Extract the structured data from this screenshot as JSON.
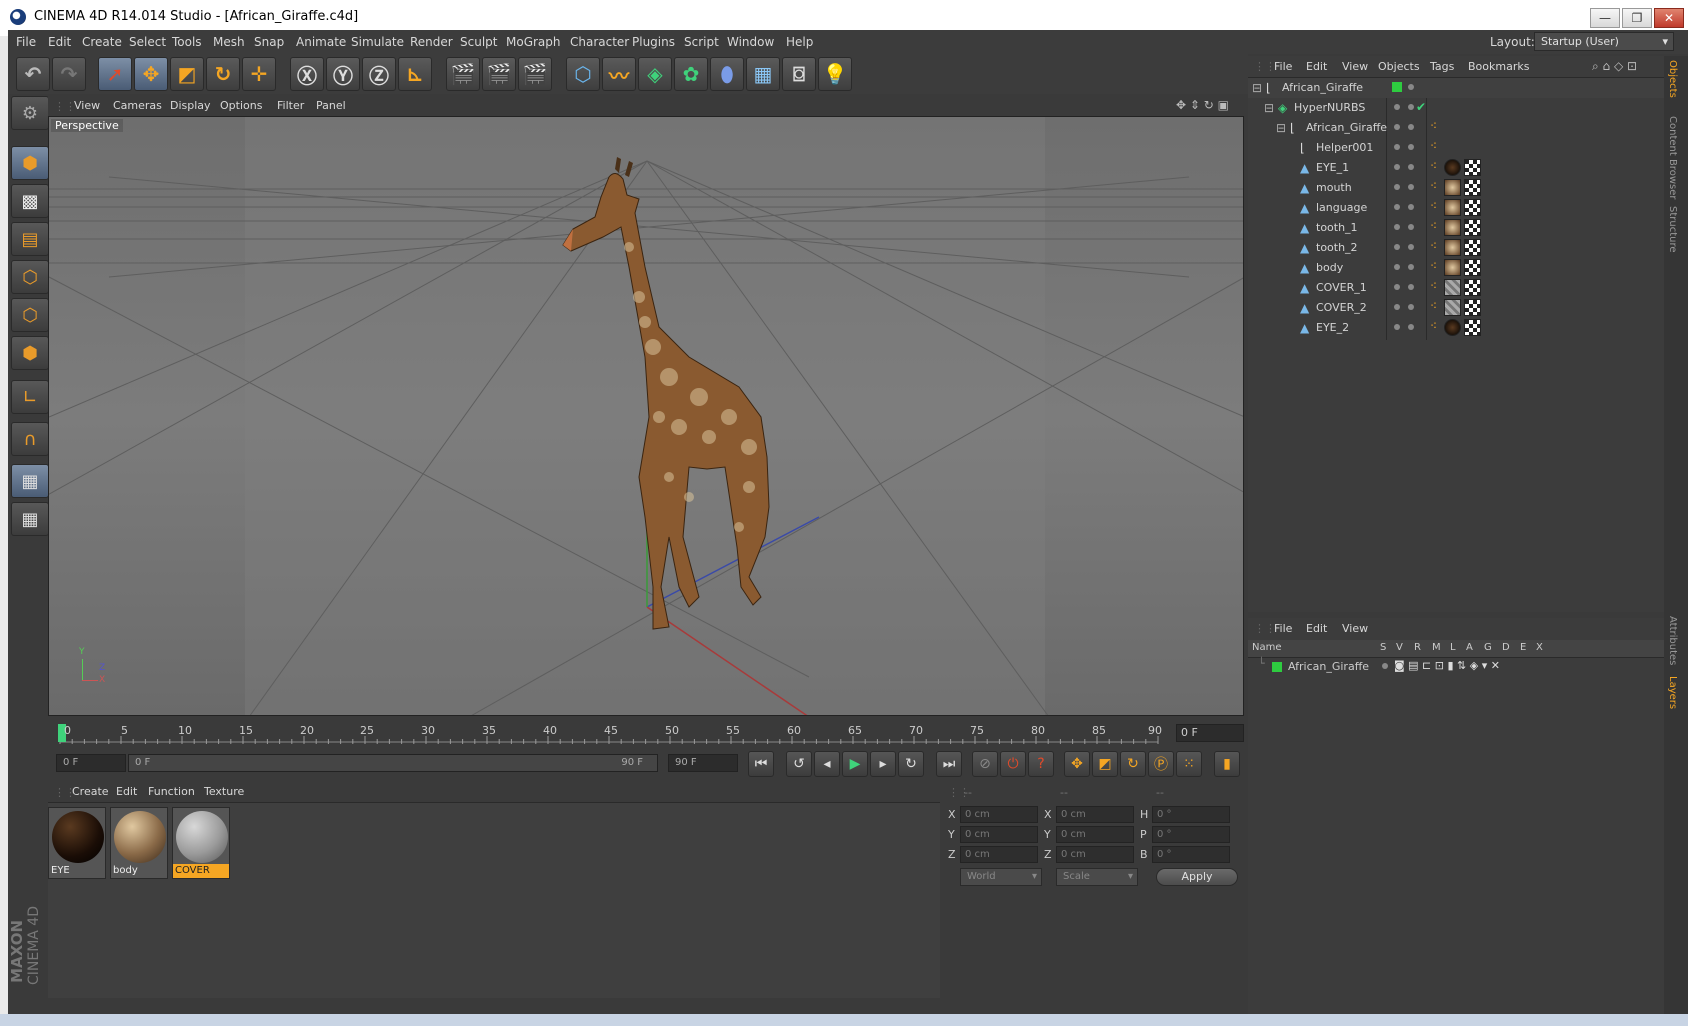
{
  "window": {
    "title": "CINEMA 4D R14.014 Studio - [African_Giraffe.c4d]",
    "minimize": "—",
    "restore": "❐",
    "close": "✕"
  },
  "menubar": {
    "items": [
      "File",
      "Edit",
      "Create",
      "Select",
      "Tools",
      "Mesh",
      "Snap",
      "Animate",
      "Simulate",
      "Render",
      "Sculpt",
      "MoGraph",
      "Character",
      "Plugins",
      "Script",
      "Window",
      "Help"
    ],
    "layout_label": "Layout:",
    "layout_value": "Startup (User)"
  },
  "viewport": {
    "menu": [
      "View",
      "Cameras",
      "Display",
      "Options",
      "Filter",
      "Panel"
    ],
    "label": "Perspective",
    "axis_y": "Y",
    "axis_x": "X",
    "axis_z": "Z"
  },
  "timeline": {
    "ticks": [
      "0",
      "5",
      "10",
      "15",
      "20",
      "25",
      "30",
      "35",
      "40",
      "45",
      "50",
      "55",
      "60",
      "65",
      "70",
      "75",
      "80",
      "85",
      "90"
    ],
    "current_frame": "0 F",
    "start_field": "0 F",
    "range_start": "0 F",
    "range_end": "90 F",
    "end_field": "90 F"
  },
  "material_manager": {
    "menu": [
      "Create",
      "Edit",
      "Function",
      "Texture"
    ],
    "materials": [
      {
        "name": "EYE",
        "color": "#1a0d06"
      },
      {
        "name": "body",
        "color": "#8a6a48"
      },
      {
        "name": "COVER",
        "color": "#9a9a9a"
      }
    ],
    "selected": "COVER"
  },
  "coordinates": {
    "headers": [
      "--",
      "--",
      "--"
    ],
    "rows": [
      {
        "l1": "X",
        "v1": "0 cm",
        "l2": "X",
        "v2": "0 cm",
        "l3": "H",
        "v3": "0 °"
      },
      {
        "l1": "Y",
        "v1": "0 cm",
        "l2": "Y",
        "v2": "0 cm",
        "l3": "P",
        "v3": "0 °"
      },
      {
        "l1": "Z",
        "v1": "0 cm",
        "l2": "Z",
        "v2": "0 cm",
        "l3": "B",
        "v3": "0 °"
      }
    ],
    "space": "World",
    "mode": "Scale",
    "apply": "Apply"
  },
  "object_manager": {
    "menu": [
      "File",
      "Edit",
      "View",
      "Objects",
      "Tags",
      "Bookmarks"
    ],
    "objects": [
      {
        "name": "African_Giraffe",
        "tag": "none"
      },
      {
        "name": "HyperNURBS",
        "tag": "check"
      },
      {
        "name": "African_Giraffe",
        "tag": "phong"
      },
      {
        "name": "Helper001",
        "tag": "phong"
      },
      {
        "name": "EYE_1",
        "tag": "eye"
      },
      {
        "name": "mouth",
        "tag": "body"
      },
      {
        "name": "language",
        "tag": "body"
      },
      {
        "name": "tooth_1",
        "tag": "body"
      },
      {
        "name": "tooth_2",
        "tag": "body"
      },
      {
        "name": "body",
        "tag": "body"
      },
      {
        "name": "COVER_1",
        "tag": "cover"
      },
      {
        "name": "COVER_2",
        "tag": "cover"
      },
      {
        "name": "EYE_2",
        "tag": "eye"
      }
    ]
  },
  "layer_manager": {
    "menu": [
      "File",
      "Edit",
      "View"
    ],
    "columns": [
      "Name",
      "S",
      "V",
      "R",
      "M",
      "L",
      "A",
      "G",
      "D",
      "E",
      "X"
    ],
    "layer": "African_Giraffe"
  },
  "side_tabs": [
    "Objects",
    "Content Browser",
    "Structure",
    "Attributes",
    "Layers"
  ],
  "brand": [
    "MAXON",
    "CINEMA 4D"
  ],
  "colors": {
    "accent": "#f5a623",
    "selected_blue": "#5a6f8c",
    "layer_green": "#2ecc40"
  }
}
